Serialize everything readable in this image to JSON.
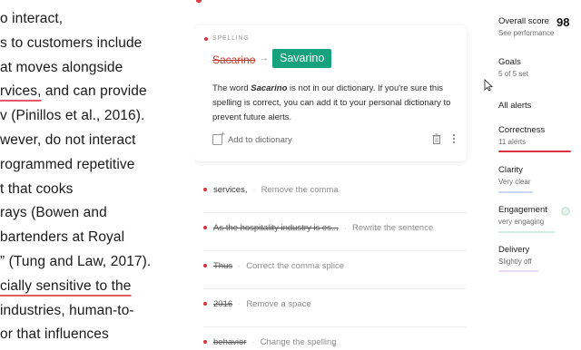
{
  "document": {
    "lines": [
      {
        "text": "o interact,"
      },
      {
        "text": "s to customers include"
      },
      {
        "text": "at moves alongside"
      },
      {
        "text_underlined": "rvices,",
        "text_rest": " and can provide"
      },
      {
        "text": "v (Pinillos et al., 2016)."
      },
      {
        "text": "wever, do not interact"
      },
      {
        "text": "rogrammed repetitive"
      },
      {
        "text": "t that cooks"
      },
      {
        "text": "rays (Bowen and"
      },
      {
        "text": "bartenders at Royal"
      },
      {
        "text": "” (Tung and Law, 2017)."
      },
      {
        "text_underlined": "cially sensitive to the",
        "text_rest": ""
      },
      {
        "text": " industries, human-to-"
      },
      {
        "text": "or that influences"
      }
    ]
  },
  "active_card": {
    "category": "SPELLING",
    "original": "Sacarino",
    "arrow": "→",
    "suggestion": "Savarino",
    "desc_prefix": "The word ",
    "desc_word": "Sacarino",
    "desc_suffix": " is not in our dictionary. If you're sure this spelling is correct, you can add it to your personal dictionary to prevent future alerts.",
    "add_to_dictionary": "Add to dictionary"
  },
  "alerts": [
    {
      "word": "services,",
      "hint": "Remove the comma",
      "strike": false
    },
    {
      "word": "As the hospitality industry is es...",
      "hint": "Rewrite the sentence",
      "strike": true
    },
    {
      "word": "Thus",
      "hint": "Correct the comma splice",
      "strike": true
    },
    {
      "word": "2016",
      "hint": "Remove a space",
      "strike": true
    },
    {
      "word": "behavior",
      "hint": "Change the spelling",
      "strike": true
    }
  ],
  "sidebar": {
    "overall_score_label": "Overall score",
    "overall_score_value": "98",
    "see_performance": "See performance",
    "goals_title": "Goals",
    "goals_sub": "5 of 5 set",
    "all_alerts": "All alerts",
    "correctness_title": "Correctness",
    "correctness_sub": "11 alerts",
    "clarity_title": "Clarity",
    "clarity_sub": "Very clear",
    "engagement_title": "Engagement",
    "engagement_sub": "very engaging",
    "delivery_title": "Delivery",
    "delivery_sub": "Slightly off"
  },
  "colors": {
    "accent_green": "#15a27c",
    "error_red": "#d8323c",
    "clarity_blue": "#4a7bd6",
    "engagement_green": "#2fb36d",
    "delivery_purple": "#a06bd8"
  }
}
